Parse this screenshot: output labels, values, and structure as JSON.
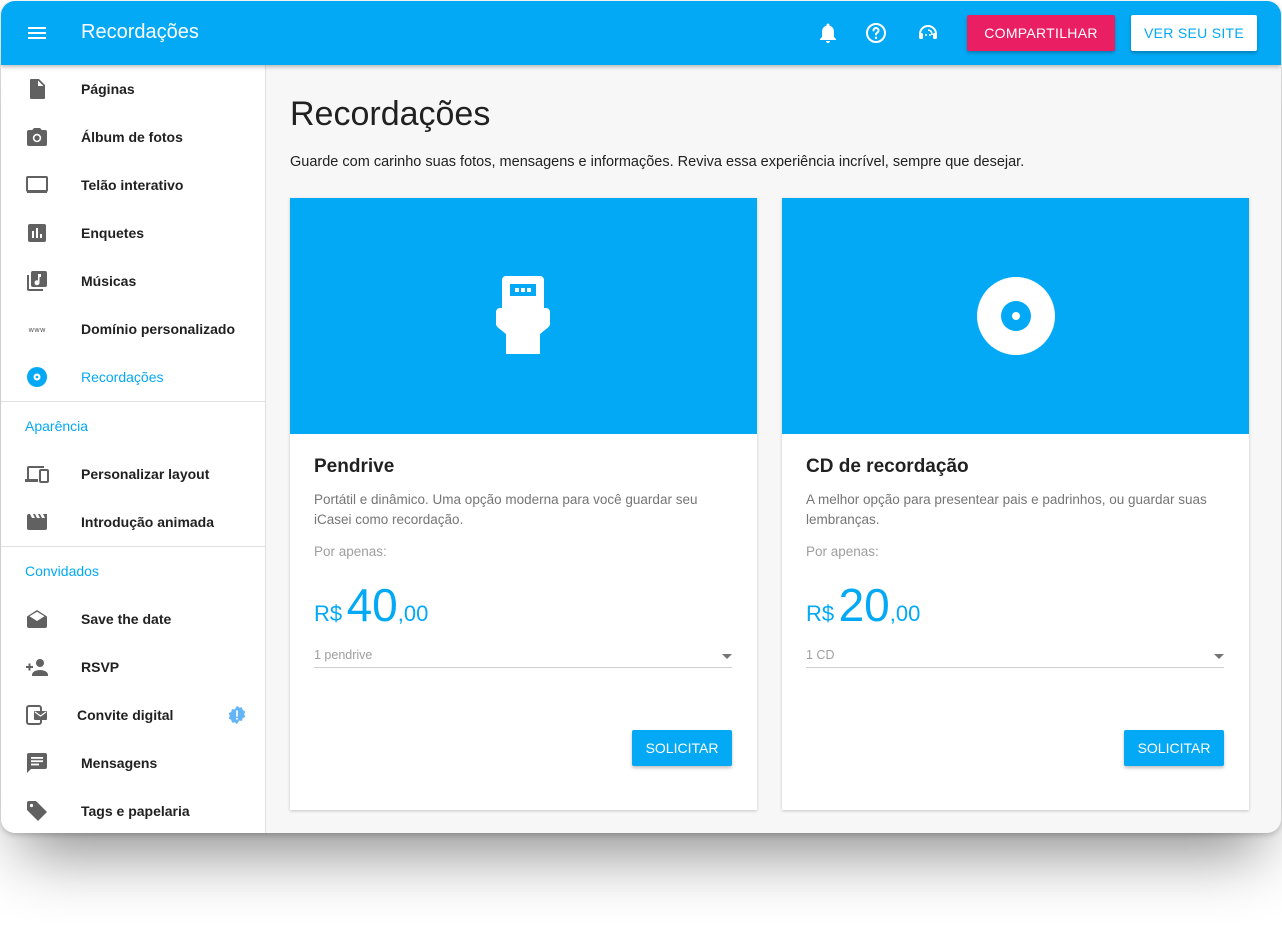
{
  "appbar": {
    "title": "Recordações",
    "share_label": "COMPARTILHAR",
    "site_label": "VER SEU SITE",
    "accent": "#03a9f4",
    "share_color": "#e91e63",
    "icons": [
      "menu-icon",
      "bell-icon",
      "help-icon",
      "support-agent-icon"
    ]
  },
  "sidebar": {
    "items": [
      {
        "label": "Páginas",
        "icon": "file-icon"
      },
      {
        "label": "Álbum de fotos",
        "icon": "camera-icon"
      },
      {
        "label": "Telão interativo",
        "icon": "monitor-icon"
      },
      {
        "label": "Enquetes",
        "icon": "poll-icon"
      },
      {
        "label": "Músicas",
        "icon": "music-library-icon"
      },
      {
        "label": "Domínio personalizado",
        "icon": "www-icon"
      },
      {
        "label": "Recordações",
        "icon": "disc-icon",
        "active": true
      }
    ],
    "section_appearance": "Aparência",
    "appearance_items": [
      {
        "label": "Personalizar layout",
        "icon": "devices-icon"
      },
      {
        "label": "Introdução animada",
        "icon": "clapperboard-icon"
      }
    ],
    "section_guests": "Convidados",
    "guest_items": [
      {
        "label": "Save the date",
        "icon": "envelope-open-icon"
      },
      {
        "label": "RSVP",
        "icon": "person-add-icon"
      },
      {
        "label": "Convite digital",
        "icon": "mobile-mail-icon",
        "badge": "!"
      },
      {
        "label": "Mensagens",
        "icon": "chat-icon"
      },
      {
        "label": "Tags e papelaria",
        "icon": "tag-icon"
      }
    ]
  },
  "main": {
    "title": "Recordações",
    "description": "Guarde com carinho suas fotos, mensagens e informações. Reviva essa experiência incrível, sempre que desejar.",
    "cards": [
      {
        "icon": "usb-icon",
        "title": "Pendrive",
        "description": "Portátil e dinâmico. Uma opção moderna para você guardar seu iCasei como recordação.",
        "from_label": "Por apenas:",
        "currency": "R$",
        "price_int": "40",
        "price_dec": ",00",
        "select_value": "1 pendrive",
        "button_label": "SOLICITAR"
      },
      {
        "icon": "cd-icon",
        "title": "CD de recordação",
        "description": "A melhor opção para presentear pais e padrinhos, ou guardar suas lembranças.",
        "from_label": "Por apenas:",
        "currency": "R$",
        "price_int": "20",
        "price_dec": ",00",
        "select_value": "1 CD",
        "button_label": "SOLICITAR"
      }
    ]
  }
}
